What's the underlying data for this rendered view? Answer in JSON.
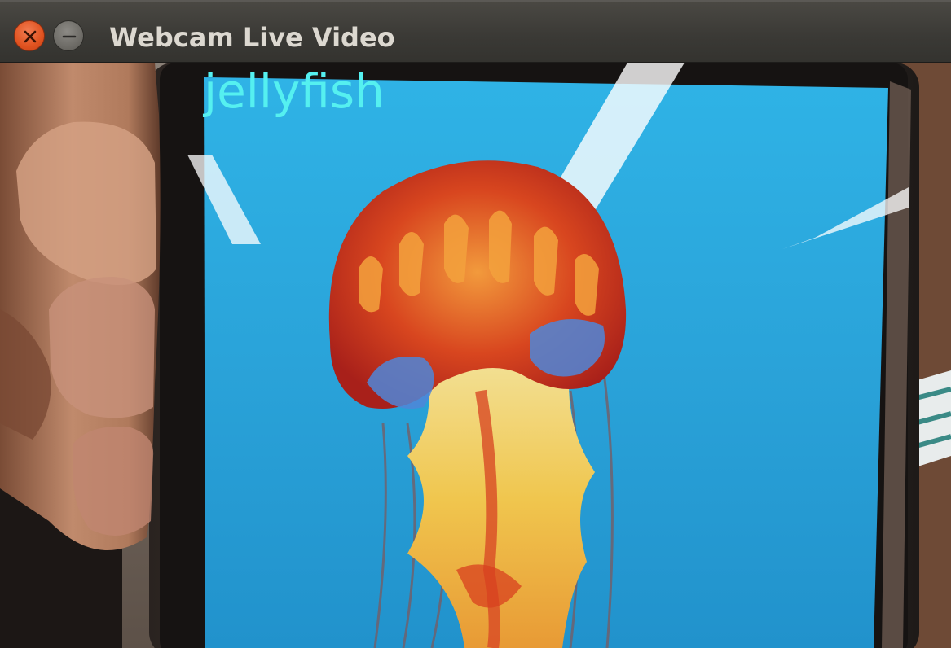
{
  "window": {
    "title": "Webcam Live Video",
    "close_icon": "close-icon",
    "minimize_icon": "minimize-icon"
  },
  "overlay": {
    "label": "jellyfish",
    "color": "#55f0f0"
  },
  "colors": {
    "close_button": "#e0521f",
    "minimize_button": "#6c6a65",
    "titlebar": "#3a3935",
    "screen_blue": "#2fa8dc"
  }
}
